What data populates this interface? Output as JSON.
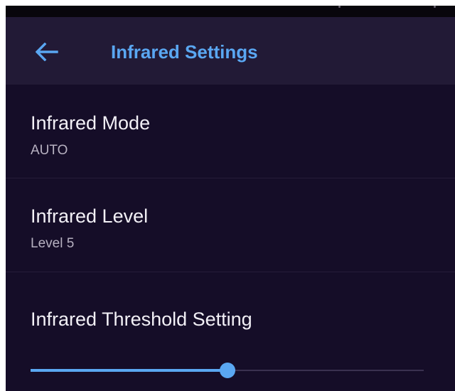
{
  "header": {
    "title": "Infrared Settings",
    "back_icon": "arrow-left-icon"
  },
  "settings": [
    {
      "title": "Infrared Mode",
      "value": "AUTO"
    },
    {
      "title": "Infrared Level",
      "value": "Level 5"
    },
    {
      "title": "Infrared Threshold Setting"
    }
  ],
  "threshold_slider": {
    "level_fraction": 0.5
  },
  "colors": {
    "background": "#150d28",
    "app_bar": "#221a36",
    "accent": "#5aa7f2",
    "primary_text": "#f2f0f6",
    "secondary_text": "#b7b1c1",
    "status_bar": "#08060c"
  }
}
